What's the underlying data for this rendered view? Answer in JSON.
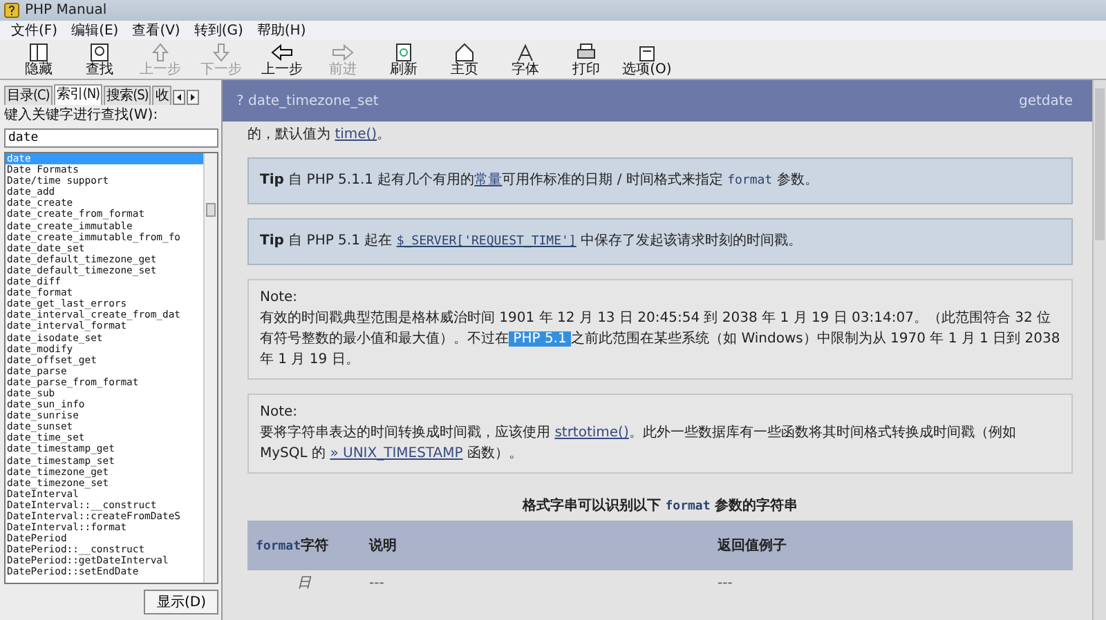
{
  "window": {
    "title": "PHP Manual"
  },
  "menu": [
    "文件(F)",
    "编辑(E)",
    "查看(V)",
    "转到(G)",
    "帮助(H)"
  ],
  "toolbar": [
    {
      "label": "隐藏",
      "kind": "hide",
      "disabled": false
    },
    {
      "label": "查找",
      "kind": "find",
      "disabled": false
    },
    {
      "label": "上一步",
      "kind": "up",
      "disabled": true
    },
    {
      "label": "下一步",
      "kind": "down",
      "disabled": true
    },
    {
      "label": "上一步",
      "kind": "back",
      "disabled": false
    },
    {
      "label": "前进",
      "kind": "forward",
      "disabled": true
    },
    {
      "label": "刷新",
      "kind": "refresh",
      "disabled": false
    },
    {
      "label": "主页",
      "kind": "home",
      "disabled": false
    },
    {
      "label": "字体",
      "kind": "font",
      "disabled": false
    },
    {
      "label": "打印",
      "kind": "print",
      "disabled": false
    },
    {
      "label": "选项(O)",
      "kind": "options",
      "disabled": false
    }
  ],
  "sidebar": {
    "tabs": [
      {
        "label": "目录(C)",
        "selected": false
      },
      {
        "label": "索引(N)",
        "selected": true
      },
      {
        "label": "搜索(S)",
        "selected": false
      },
      {
        "label": "收",
        "selected": false
      }
    ],
    "search_label": "键入关键字进行查找(W):",
    "search_value": "date",
    "items": [
      {
        "label": "date",
        "selected": true
      },
      {
        "label": "Date Formats",
        "selected": false
      },
      {
        "label": "Date/time support",
        "selected": false
      },
      {
        "label": "date_add",
        "selected": false
      },
      {
        "label": "date_create",
        "selected": false
      },
      {
        "label": "date_create_from_format",
        "selected": false
      },
      {
        "label": "date_create_immutable",
        "selected": false
      },
      {
        "label": "date_create_immutable_from_fo",
        "selected": false
      },
      {
        "label": "date_date_set",
        "selected": false
      },
      {
        "label": "date_default_timezone_get",
        "selected": false
      },
      {
        "label": "date_default_timezone_set",
        "selected": false
      },
      {
        "label": "date_diff",
        "selected": false
      },
      {
        "label": "date_format",
        "selected": false
      },
      {
        "label": "date_get_last_errors",
        "selected": false
      },
      {
        "label": "date_interval_create_from_dat",
        "selected": false
      },
      {
        "label": "date_interval_format",
        "selected": false
      },
      {
        "label": "date_isodate_set",
        "selected": false
      },
      {
        "label": "date_modify",
        "selected": false
      },
      {
        "label": "date_offset_get",
        "selected": false
      },
      {
        "label": "date_parse",
        "selected": false
      },
      {
        "label": "date_parse_from_format",
        "selected": false
      },
      {
        "label": "date_sub",
        "selected": false
      },
      {
        "label": "date_sun_info",
        "selected": false
      },
      {
        "label": "date_sunrise",
        "selected": false
      },
      {
        "label": "date_sunset",
        "selected": false
      },
      {
        "label": "date_time_set",
        "selected": false
      },
      {
        "label": "date_timestamp_get",
        "selected": false
      },
      {
        "label": "date_timestamp_set",
        "selected": false
      },
      {
        "label": "date_timezone_get",
        "selected": false
      },
      {
        "label": "date_timezone_set",
        "selected": false
      },
      {
        "label": "DateInterval",
        "selected": false
      },
      {
        "label": "DateInterval::__construct",
        "selected": false
      },
      {
        "label": "DateInterval::createFromDateS",
        "selected": false
      },
      {
        "label": "DateInterval::format",
        "selected": false
      },
      {
        "label": "DatePeriod",
        "selected": false
      },
      {
        "label": "DatePeriod::__construct",
        "selected": false
      },
      {
        "label": "DatePeriod::getDateInterval",
        "selected": false
      },
      {
        "label": "DatePeriod::setEndDate",
        "selected": false
      }
    ],
    "display_button": "显示(D)"
  },
  "header": {
    "prev": "? date_timezone_set",
    "next": "getdate"
  },
  "blocks": [
    {
      "kind": "para",
      "segments": [
        {
          "kind": "text",
          "text": "的，默认值为 "
        },
        {
          "kind": "link",
          "text": "time()"
        },
        {
          "kind": "text",
          "text": "。"
        }
      ]
    },
    {
      "kind": "tip",
      "title": "Tip",
      "segments": [
        {
          "kind": "text",
          "text": "自 PHP 5.1.1 起有几个有用的"
        },
        {
          "kind": "link",
          "text": "常量"
        },
        {
          "kind": "text",
          "text": "可用作标准的日期 / 时间格式来指定 "
        },
        {
          "kind": "code",
          "text": "format"
        },
        {
          "kind": "text",
          "text": " 参数。"
        }
      ]
    },
    {
      "kind": "tip",
      "title": "Tip",
      "segments": [
        {
          "kind": "text",
          "text": "自 PHP 5.1 起在 "
        },
        {
          "kind": "codelink",
          "text": "$_SERVER['REQUEST_TIME']"
        },
        {
          "kind": "text",
          "text": " 中保存了发起该请求时刻的时间戳。"
        }
      ]
    },
    {
      "kind": "note",
      "title": "Note:",
      "segments": [
        {
          "kind": "text",
          "text": "有效的时间戳典型范围是格林威治时间 1901 年 12 月 13 日 20:45:54 到 2038 年 1 月 19 日 03:14:07。（此范围符合 32 位有符号整数的最小值和最大值）。不过在"
        },
        {
          "kind": "highlight",
          "text": " PHP 5.1 "
        },
        {
          "kind": "text",
          "text": "之前此范围在某些系统（如 Windows）中限制为从 1970 年 1 月 1 日到 2038 年 1 月 19 日。"
        }
      ]
    },
    {
      "kind": "note",
      "title": "Note:",
      "segments": [
        {
          "kind": "text",
          "text": "要将字符串表达的时间转换成时间戳，应该使用 "
        },
        {
          "kind": "link",
          "text": "strtotime()"
        },
        {
          "kind": "text",
          "text": "。此外一些数据库有一些函数将其时间格式转换成时间戳（例如 MySQL 的 "
        },
        {
          "kind": "link",
          "text": "» UNIX_TIMESTAMP"
        },
        {
          "kind": "text",
          "text": " 函数）。"
        }
      ]
    }
  ],
  "table": {
    "caption": [
      {
        "kind": "text",
        "text": "格式字串可以识别以下 "
      },
      {
        "kind": "code",
        "text": "format"
      },
      {
        "kind": "text",
        "text": " 参数的字符串"
      }
    ],
    "columns": [
      {
        "code": "format",
        "label": "字符"
      },
      {
        "label": "说明"
      },
      {
        "label": "返回值例子"
      }
    ],
    "rows": [
      [
        "日",
        "---",
        "---"
      ]
    ]
  }
}
